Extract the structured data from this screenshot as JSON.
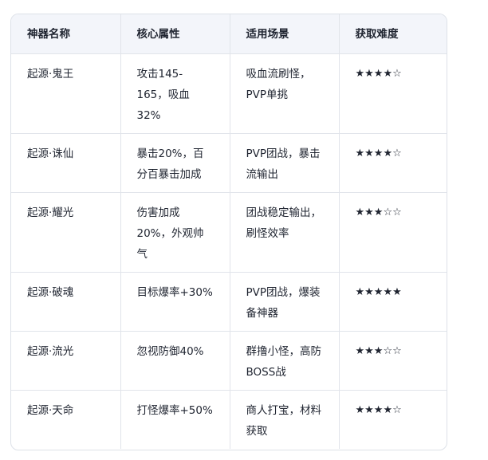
{
  "table": {
    "headers": [
      "神器名称",
      "核心属性",
      "适用场景",
      "获取难度"
    ],
    "rows": [
      {
        "name": "起源·鬼王",
        "attr": "攻击145-165，吸血32%",
        "scene": "吸血流刷怪，PVP单挑",
        "difficulty": "★★★★☆"
      },
      {
        "name": "起源·诛仙",
        "attr": "暴击20%，百分百暴击加成",
        "scene": "PVP团战，暴击流输出",
        "difficulty": "★★★★☆"
      },
      {
        "name": "起源·耀光",
        "attr": "伤害加成20%，外观帅气",
        "scene": "团战稳定输出，刷怪效率",
        "difficulty": "★★★☆☆"
      },
      {
        "name": "起源·破魂",
        "attr": "目标爆率+30%",
        "scene": "PVP团战，爆装备神器",
        "difficulty": "★★★★★"
      },
      {
        "name": "起源·流光",
        "attr": "忽视防御40%",
        "scene": "群撸小怪，高防BOSS战",
        "difficulty": "★★★☆☆"
      },
      {
        "name": "起源·天命",
        "attr": "打怪爆率+50%",
        "scene": "商人打宝，材料获取",
        "difficulty": "★★★★☆"
      }
    ]
  }
}
